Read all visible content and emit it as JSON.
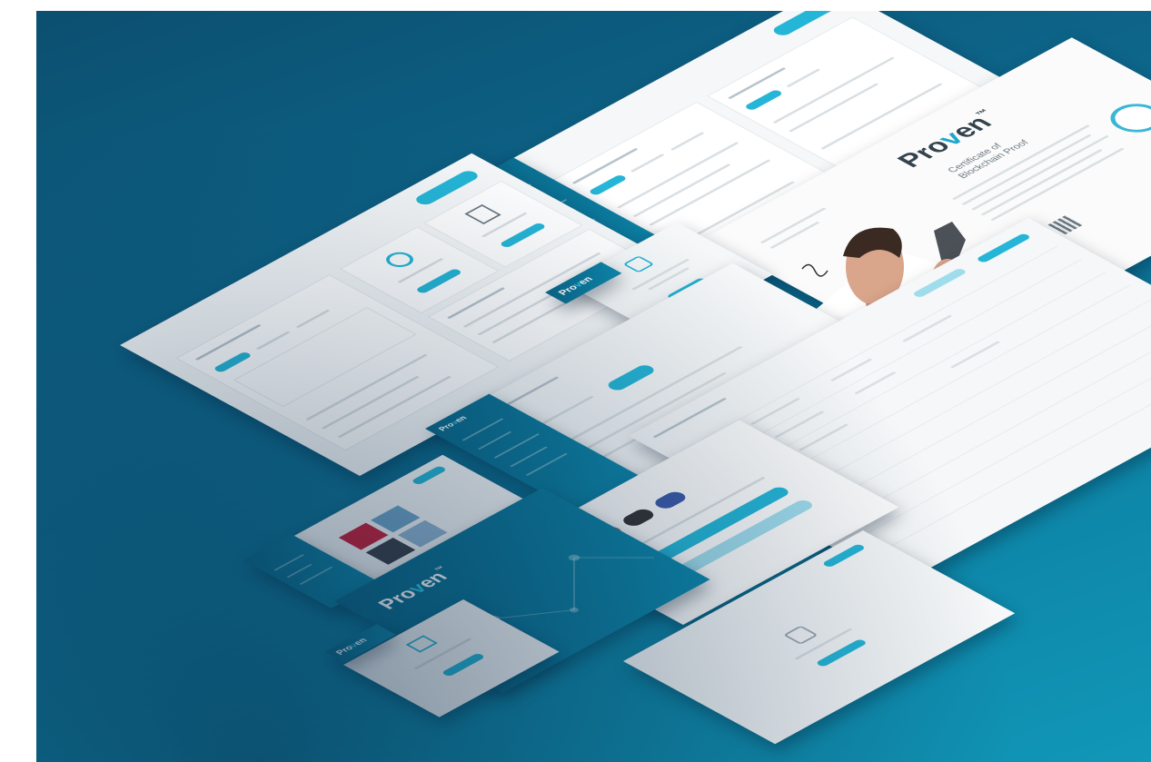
{
  "brand": {
    "name_prefix": "Pro",
    "name_accent": "v",
    "name_suffix": "en",
    "trademark": "™"
  },
  "certificate": {
    "title_line1": "Certificate of",
    "title_line2": "Blockchain Proof"
  },
  "colors": {
    "background_dark": "#0c4f70",
    "background_light": "#1197b8",
    "accent": "#25b5d6",
    "card": "#f5f7f8"
  },
  "icons": [
    "thumbs-up-icon",
    "upload-icon",
    "google-icon",
    "github-icon",
    "facebook-icon",
    "seal-icon",
    "qr-code-icon"
  ]
}
